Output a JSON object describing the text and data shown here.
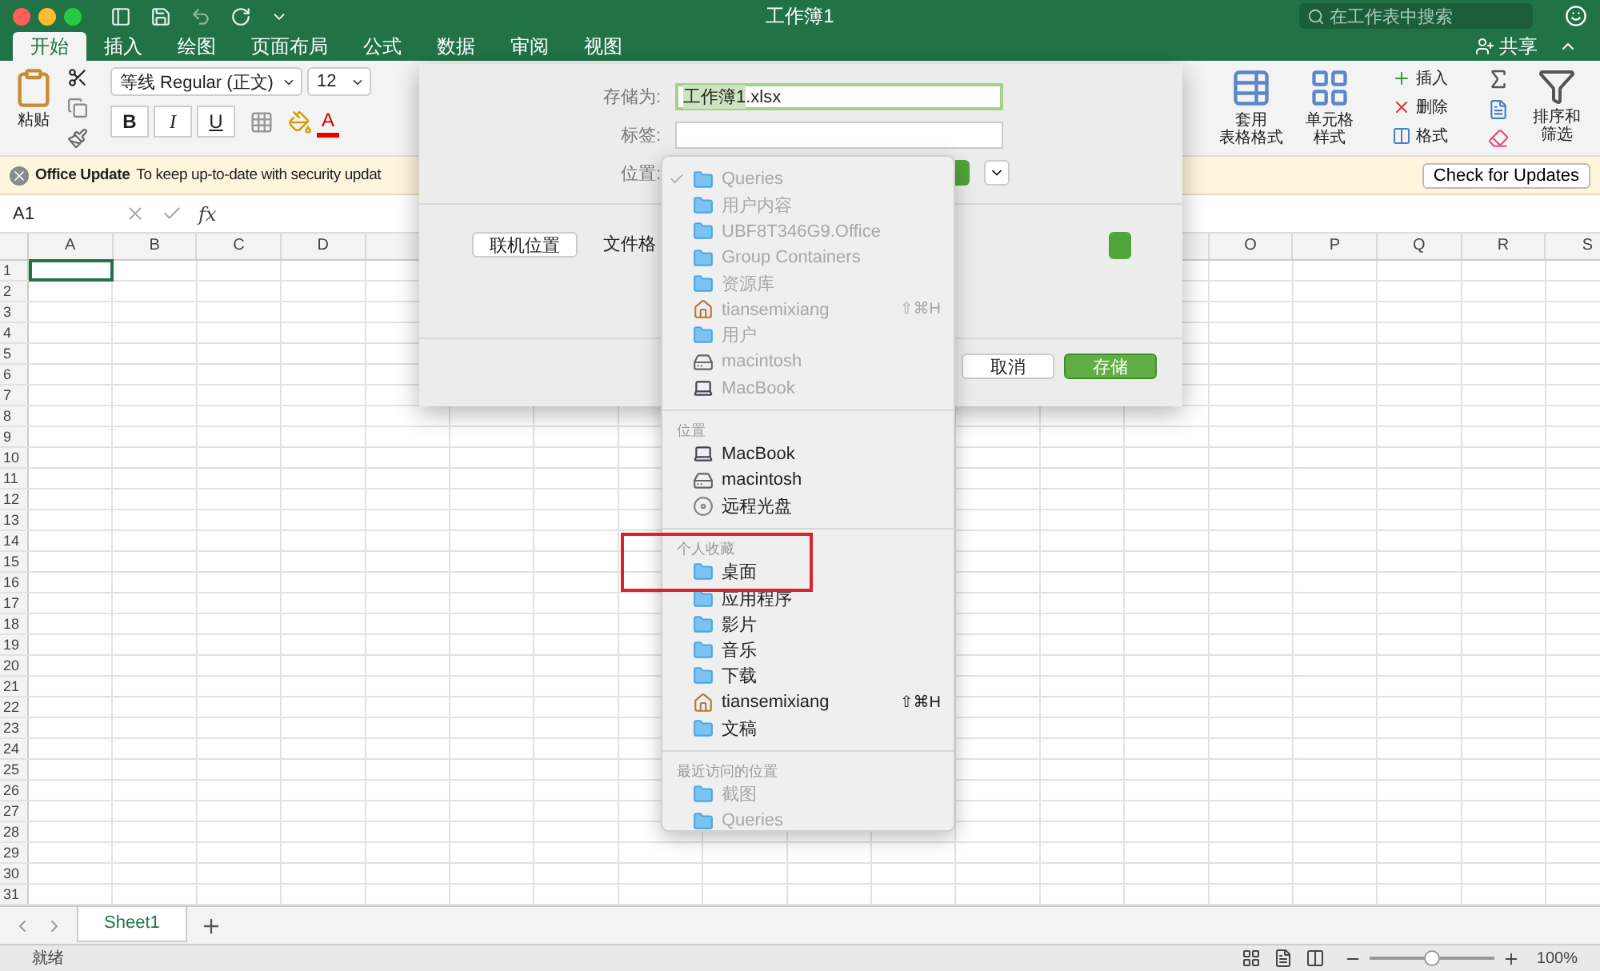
{
  "window": {
    "title": "工作簿1",
    "search_placeholder": "在工作表中搜索"
  },
  "tabs": [
    {
      "label": "开始",
      "selected": true
    },
    {
      "label": "插入",
      "selected": false
    },
    {
      "label": "绘图",
      "selected": false
    },
    {
      "label": "页面布局",
      "selected": false
    },
    {
      "label": "公式",
      "selected": false
    },
    {
      "label": "数据",
      "selected": false
    },
    {
      "label": "审阅",
      "selected": false
    },
    {
      "label": "视图",
      "selected": false
    }
  ],
  "share": "共享",
  "ribbon": {
    "paste": "粘贴",
    "font_name": "等线 Regular (正文)",
    "font_size": "12",
    "bold": "B",
    "italic": "I",
    "underline": "U",
    "font_color": "A",
    "table_format": [
      "套用",
      "表格格式"
    ],
    "cell_style": [
      "单元格",
      "样式"
    ],
    "insert": "插入",
    "delete": "删除",
    "format": "格式",
    "sort_filter": [
      "排序和",
      "筛选"
    ]
  },
  "update_bar": {
    "title": "Office Update",
    "message": "To keep up-to-date with security updat",
    "button": "Check for Updates"
  },
  "formula_bar": {
    "name_box": "A1",
    "function_label": "fx"
  },
  "sheet": {
    "columns_left": [
      "A",
      "B",
      "C",
      "D"
    ],
    "columns_right": [
      "O",
      "P",
      "Q",
      "R",
      "S"
    ],
    "rows": [
      "1",
      "2",
      "3",
      "4",
      "5",
      "6",
      "7",
      "8",
      "9",
      "10",
      "11",
      "12",
      "13",
      "14",
      "15",
      "16",
      "17",
      "18",
      "19",
      "20",
      "21",
      "22",
      "23",
      "24",
      "25",
      "26",
      "27",
      "28",
      "29",
      "30",
      "31"
    ]
  },
  "save_dialog": {
    "save_as_label": "存储为:",
    "file_name_selected": "工作簿1",
    "file_name_rest": ".xlsx",
    "tags_label": "标签:",
    "location_label": "位置:",
    "online_button": "联机位置",
    "format_label": "文件格",
    "cancel": "取消",
    "save": "存储"
  },
  "location_menu": {
    "sections": [
      {
        "items": [
          {
            "label": "Queries",
            "kind": "folder",
            "checked": true,
            "dimmed": true
          },
          {
            "label": "用户内容",
            "kind": "folder",
            "checked": false,
            "dimmed": true
          },
          {
            "label": "UBF8T346G9.Office",
            "kind": "folder",
            "checked": false,
            "dimmed": true
          },
          {
            "label": "Group Containers",
            "kind": "folder",
            "checked": false,
            "dimmed": true
          },
          {
            "label": "资源库",
            "kind": "folder",
            "checked": false,
            "dimmed": true
          },
          {
            "label": "tiansemixiang",
            "kind": "home",
            "shortcut": "⇧⌘H",
            "checked": false,
            "dimmed": true
          },
          {
            "label": "用户",
            "kind": "folder",
            "checked": false,
            "dimmed": true
          },
          {
            "label": "macintosh",
            "kind": "disk",
            "checked": false,
            "dimmed": true
          },
          {
            "label": "MacBook",
            "kind": "laptop",
            "checked": false,
            "dimmed": true
          }
        ]
      },
      {
        "heading": "位置",
        "items": [
          {
            "label": "MacBook",
            "kind": "laptop",
            "checked": false,
            "dimmed": false
          },
          {
            "label": "macintosh",
            "kind": "disk",
            "checked": false,
            "dimmed": false
          },
          {
            "label": "远程光盘",
            "kind": "disc",
            "checked": false,
            "dimmed": false
          }
        ]
      },
      {
        "heading": "个人收藏",
        "items": [
          {
            "label": "桌面",
            "kind": "folder",
            "checked": false,
            "dimmed": false
          },
          {
            "label": "应用程序",
            "kind": "folder",
            "checked": false,
            "dimmed": false
          },
          {
            "label": "影片",
            "kind": "folder",
            "checked": false,
            "dimmed": false
          },
          {
            "label": "音乐",
            "kind": "folder",
            "checked": false,
            "dimmed": false
          },
          {
            "label": "下载",
            "kind": "folder",
            "checked": false,
            "dimmed": false
          },
          {
            "label": "tiansemixiang",
            "kind": "home",
            "shortcut": "⇧⌘H",
            "checked": false,
            "dimmed": false
          },
          {
            "label": "文稿",
            "kind": "folder",
            "checked": false,
            "dimmed": false
          }
        ]
      },
      {
        "heading": "最近访问的位置",
        "items": [
          {
            "label": "截图",
            "kind": "folder",
            "checked": false,
            "dimmed": true
          },
          {
            "label": "Queries",
            "kind": "folder",
            "checked": false,
            "dimmed": true
          }
        ]
      }
    ]
  },
  "sheet_tabs": [
    {
      "label": "Sheet1",
      "selected": true
    }
  ],
  "status_bar": {
    "status": "就绪",
    "zoom": {
      "level": 0.5,
      "reading": "100%"
    }
  }
}
